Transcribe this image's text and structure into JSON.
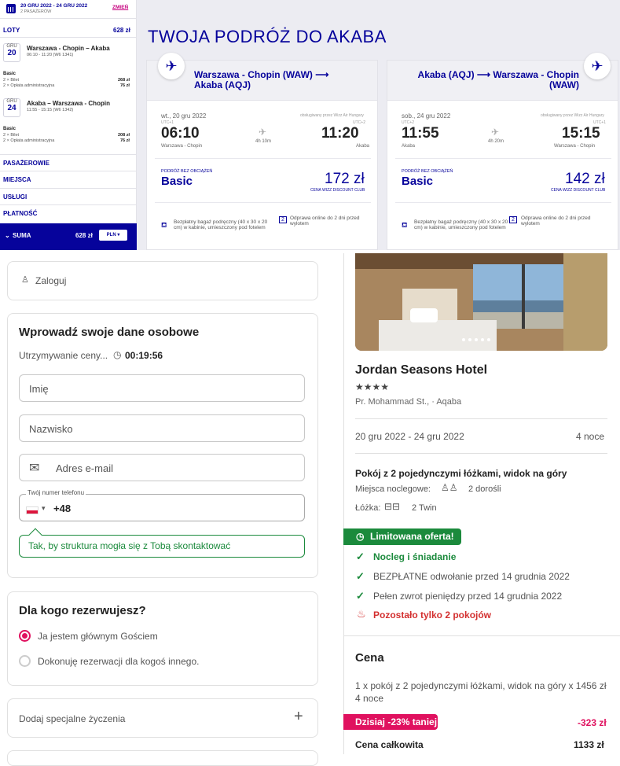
{
  "sidebar": {
    "dates": "20 GRU 2022 - 24 GRU 2022",
    "passengers": "2 PASAŻERÓW",
    "change": "ZMIEŃ",
    "flights_label": "LOTY",
    "flights_total": "628 zł",
    "seg1": {
      "month": "GRU",
      "day": "20",
      "route": "Warszawa - Chopin – Akaba",
      "time": "06:10 - 11:20 (W6 1341)",
      "fare": "Basic",
      "l1": "2 × Bilet",
      "v1": "268 zł",
      "l2": "2 × Opłata administracyjna",
      "v2": "76 zł"
    },
    "seg2": {
      "month": "GRU",
      "day": "24",
      "route": "Akaba – Warszawa - Chopin",
      "time": "11:55 - 15:15 (W6 1342)",
      "fare": "Basic",
      "l1": "2 × Bilet",
      "v1": "208 zł",
      "l2": "2 × Opłata administracyjna",
      "v2": "76 zł"
    },
    "sections": [
      "PASAŻEROWIE",
      "MIEJSCA",
      "USŁUGI",
      "PŁATNOŚĆ"
    ],
    "sum_label": "SUMA",
    "sum_value": "628 zł",
    "currency": "PLN"
  },
  "wizz": {
    "title": "TWOJA PODRÓŻ DO AKABA",
    "out": {
      "route": "Warszawa - Chopin (WAW) ⟶ Akaba (AQJ)",
      "date": "wt., 20 gru 2022",
      "operated": "obsługiwany przez Wizz Air Hungary",
      "utc1": "UTC+1",
      "utc2": "UTC+2",
      "dep": "06:10",
      "arr": "11:20",
      "duration": "4h 10m",
      "from": "Warszawa - Chopin",
      "to": "Akaba",
      "fare_label": "PODRÓŻ BEZ OBCIĄŻEŃ",
      "fare": "Basic",
      "price": "172 zł",
      "club": "CENA WIZZ DISCOUNT CLUB",
      "bag": "Bezpłatny bagaż podręczny (40 x 30 x 20 cm) w kabinie, umieszczony pod fotelem",
      "checkin": "Odprawa online do 2 dni przed wylotem"
    },
    "ret": {
      "route": "Akaba (AQJ) ⟶ Warszawa - Chopin (WAW)",
      "date": "sob., 24 gru 2022",
      "operated": "obsługiwany przez Wizz Air Hungary",
      "utc1": "UTC+2",
      "utc2": "UTC+1",
      "dep": "11:55",
      "arr": "15:15",
      "duration": "4h 20m",
      "from": "Akaba",
      "to": "Warszawa - Chopin",
      "fare_label": "PODRÓŻ BEZ OBCIĄŻEŃ",
      "fare": "Basic",
      "price": "142 zł",
      "club": "CENA WIZZ DISCOUNT CLUB",
      "bag": "Bezpłatny bagaż podręczny (40 x 30 x 20 cm) w kabinie, umieszczony pod fotelem",
      "checkin": "Odprawa online do 2 dni przed wylotem"
    }
  },
  "booking": {
    "login": "Zaloguj",
    "form_title": "Wprowadź swoje dane osobowe",
    "hold": "Utrzymywanie ceny...",
    "timer": "00:19:56",
    "first_name": "Imię",
    "last_name": "Nazwisko",
    "email": "Adres e-mail",
    "phone_label": "Twój numer telefonu",
    "phone_code": "+48",
    "phone_hint": "Tak, by struktura mogła się z Tobą skontaktować",
    "who_title": "Dla kogo rezerwujesz?",
    "opt1": "Ja jestem głównym Gościem",
    "opt2": "Dokonuję rezerwacji dla kogoś innego.",
    "special": "Dodaj specjalne życzenia",
    "plus": "+"
  },
  "hotel": {
    "name": "Jordan Seasons Hotel",
    "stars": "★★★★",
    "address": "Pr. Mohammad St., · Aqaba",
    "dates": "20 gru 2022 - 24 gru 2022",
    "nights": "4 noce",
    "room": "Pokój z 2 pojedynczymi łóżkami, widok na góry",
    "occupancy_label": "Miejsca noclegowe:",
    "occupancy": "2 dorośli",
    "beds_label": "Łóżka:",
    "beds": "2 Twin",
    "limited": "Limitowana oferta!",
    "b1": "Nocleg i śniadanie",
    "b2": "BEZPŁATNE odwołanie przed 14 grudnia 2022",
    "b3": "Pełen zwrot pieniędzy przed 14 grudnia 2022",
    "rooms_left": "Pozostało tylko 2 pokojów",
    "price_title": "Cena",
    "price_line": "1 x pokój z 2 pojedynczymi łóżkami, widok na góry x 1456 zł 4 noce",
    "discount_label": "Dzisiaj -23% taniej",
    "discount": "-323 zł",
    "total_label": "Cena całkowita",
    "total": "1133 zł"
  },
  "colors": {
    "wizz_blue": "#06039b",
    "wizz_pink": "#c6007e",
    "accent": "#e0115f",
    "green": "#1b8a3c"
  }
}
